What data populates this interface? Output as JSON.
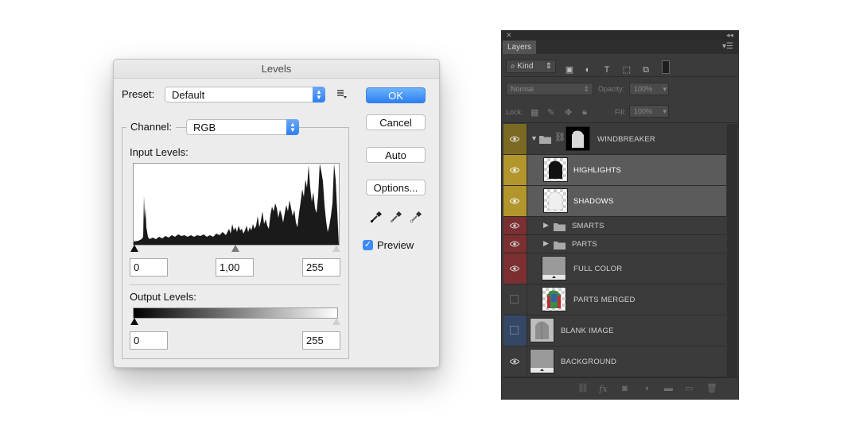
{
  "levels": {
    "title": "Levels",
    "preset_label": "Preset:",
    "preset_value": "Default",
    "channel_label": "Channel:",
    "channel_value": "RGB",
    "input_levels_label": "Input Levels:",
    "input_black": "0",
    "input_gamma": "1,00",
    "input_white": "255",
    "output_levels_label": "Output Levels:",
    "output_black": "0",
    "output_white": "255",
    "buttons": {
      "ok": "OK",
      "cancel": "Cancel",
      "auto": "Auto",
      "options": "Options..."
    },
    "preview_label": "Preview",
    "preview_checked": true,
    "accent": "#2f7ff2"
  },
  "layers_panel": {
    "tab_label": "Layers",
    "filter_kind": "Kind",
    "blend_mode": "Normal",
    "opacity_label": "Opacity:",
    "opacity_value": "100%",
    "lock_label": "Lock:",
    "fill_label": "Fill:",
    "fill_value": "100%",
    "layers": [
      {
        "name": "WINDBREAKER",
        "type": "group",
        "expanded": true,
        "visible": true,
        "color": "#7d6a22"
      },
      {
        "name": "HIGHLIGHTS",
        "type": "layer",
        "visible": true,
        "selected": true,
        "color": "#b3962b"
      },
      {
        "name": "SHADOWS",
        "type": "layer",
        "visible": true,
        "selected": true,
        "color": "#b3962b"
      },
      {
        "name": "SMARTS",
        "type": "group",
        "expanded": false,
        "visible": true,
        "color": "#7c2f31"
      },
      {
        "name": "PARTS",
        "type": "group",
        "expanded": false,
        "visible": true,
        "color": "#7c2f31"
      },
      {
        "name": "FULL COLOR",
        "type": "layer",
        "visible": true,
        "color": "#7c2f31"
      },
      {
        "name": "PARTS MERGED",
        "type": "layer",
        "visible": false,
        "color": "#3b3b3b"
      },
      {
        "name": "BLANK IMAGE",
        "type": "layer",
        "visible": false,
        "color": "#344866"
      },
      {
        "name": "BACKGROUND",
        "type": "layer",
        "visible": true,
        "color": "#3b3b3b"
      }
    ]
  }
}
